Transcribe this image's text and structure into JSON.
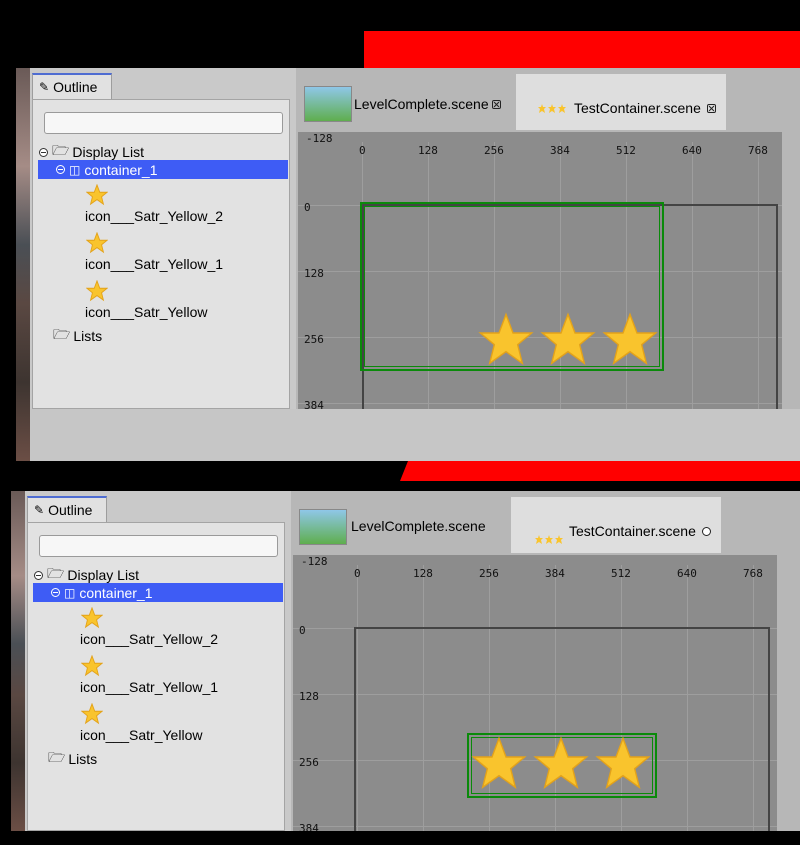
{
  "colors": {
    "accent_selected": "#3e5cf5",
    "red_marker": "#ff0000",
    "selection_border": "#0a8a0a"
  },
  "outline": {
    "tab_label": "Outline",
    "search_value": "",
    "tree": {
      "display_list": "Display List",
      "container": "container_1",
      "children": [
        "icon___Satr_Yellow_2",
        "icon___Satr_Yellow_1",
        "icon___Satr_Yellow"
      ],
      "lists": "Lists"
    }
  },
  "editor": {
    "tabs": [
      {
        "label": "LevelComplete.scene",
        "state": "inactive"
      },
      {
        "label": "TestContainer.scene",
        "state": "active"
      }
    ],
    "ruler_x": [
      "-128",
      "0",
      "128",
      "256",
      "384",
      "512",
      "640",
      "768"
    ],
    "ruler_y": [
      "0",
      "128",
      "256",
      "384"
    ],
    "star_count": 3
  },
  "icons": {
    "outline": "outline-tree-icon",
    "folder": "folder-icon",
    "container": "container-icon",
    "star": "star-icon",
    "close": "close-icon",
    "dirty": "dirty-circle-icon"
  }
}
